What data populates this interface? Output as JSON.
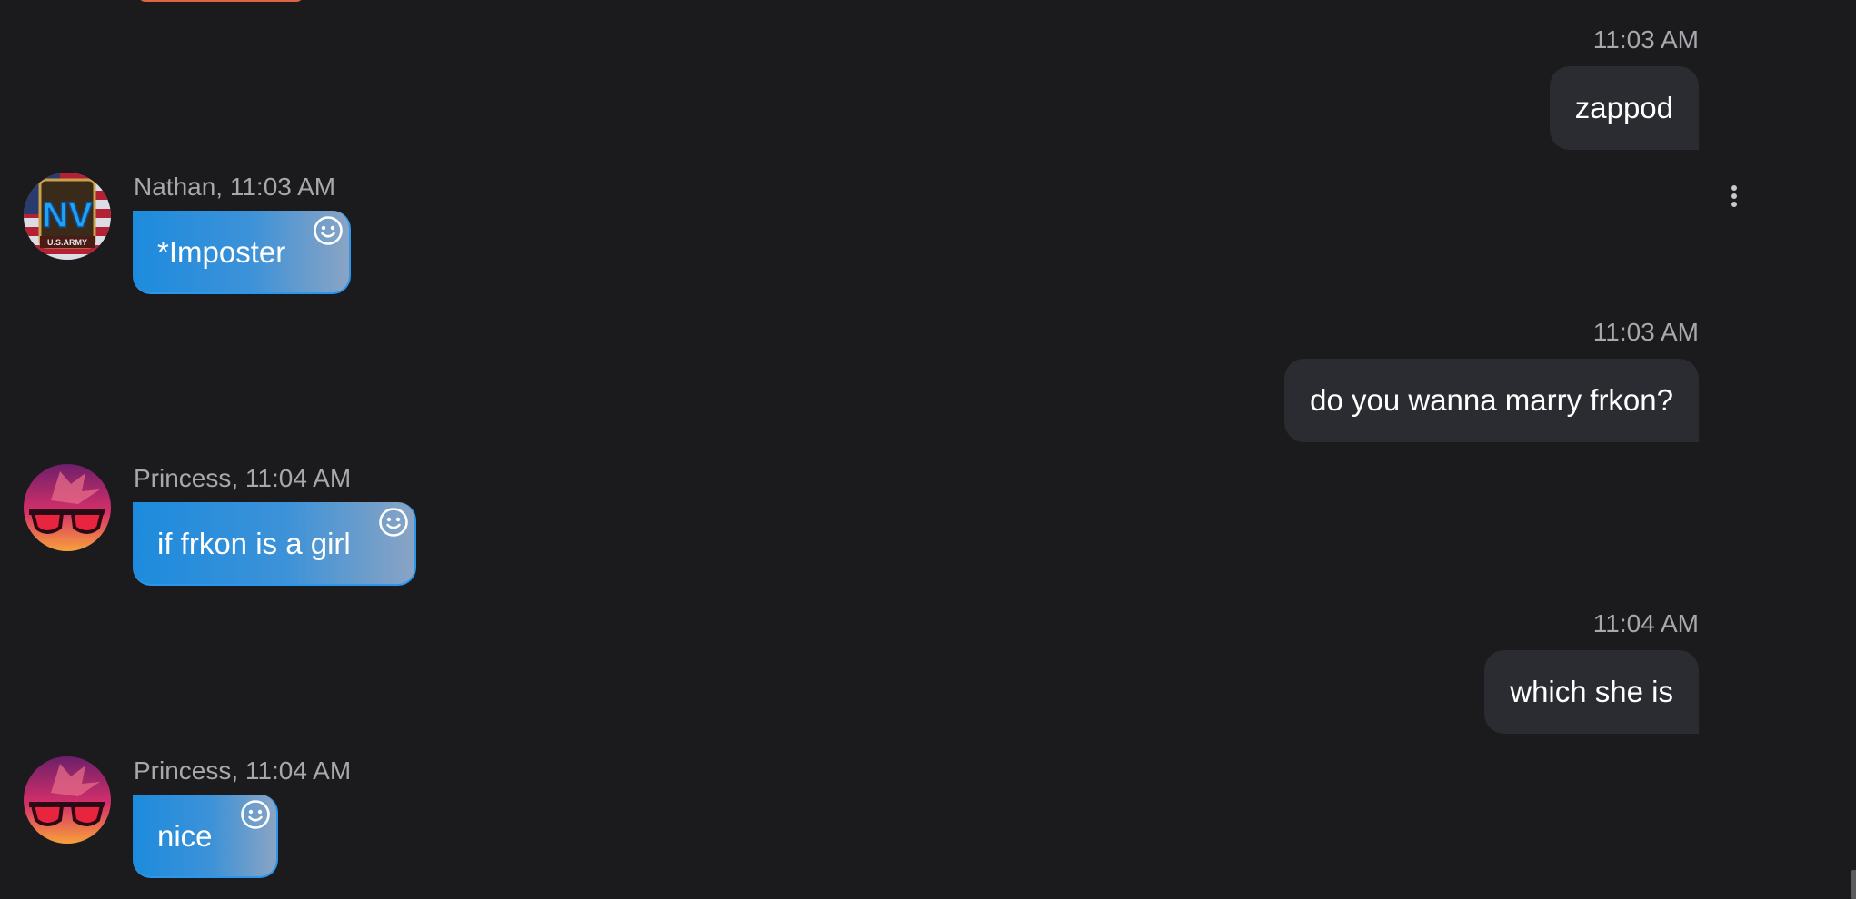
{
  "messages": [
    {
      "direction": "outgoing",
      "time": "11:03 AM",
      "text": "zappod"
    },
    {
      "direction": "incoming",
      "sender": "Nathan, 11:03 AM",
      "text": "*Imposter",
      "avatar": "nathan-us-army-nv-avatar"
    },
    {
      "direction": "outgoing",
      "time": "11:03 AM",
      "text": "do you wanna marry frkon?"
    },
    {
      "direction": "incoming",
      "sender": "Princess, 11:04 AM",
      "text": "if frkon is a girl",
      "avatar": "princess-sunglasses-avatar"
    },
    {
      "direction": "outgoing",
      "time": "11:04 AM",
      "text": "which she is"
    },
    {
      "direction": "incoming",
      "sender": "Princess, 11:04 AM",
      "text": "nice",
      "avatar": "princess-sunglasses-avatar"
    }
  ],
  "icons": {
    "emoji_reaction": "smiley-face-icon",
    "more_options": "vertical-ellipsis-icon"
  },
  "colors": {
    "background": "#1b1b1e",
    "outgoing_bubble": "#2b2c32",
    "incoming_bubble_start": "#1d8bdd",
    "incoming_bubble_end": "#8aa4c4",
    "meta_text": "#a7a7ac"
  }
}
